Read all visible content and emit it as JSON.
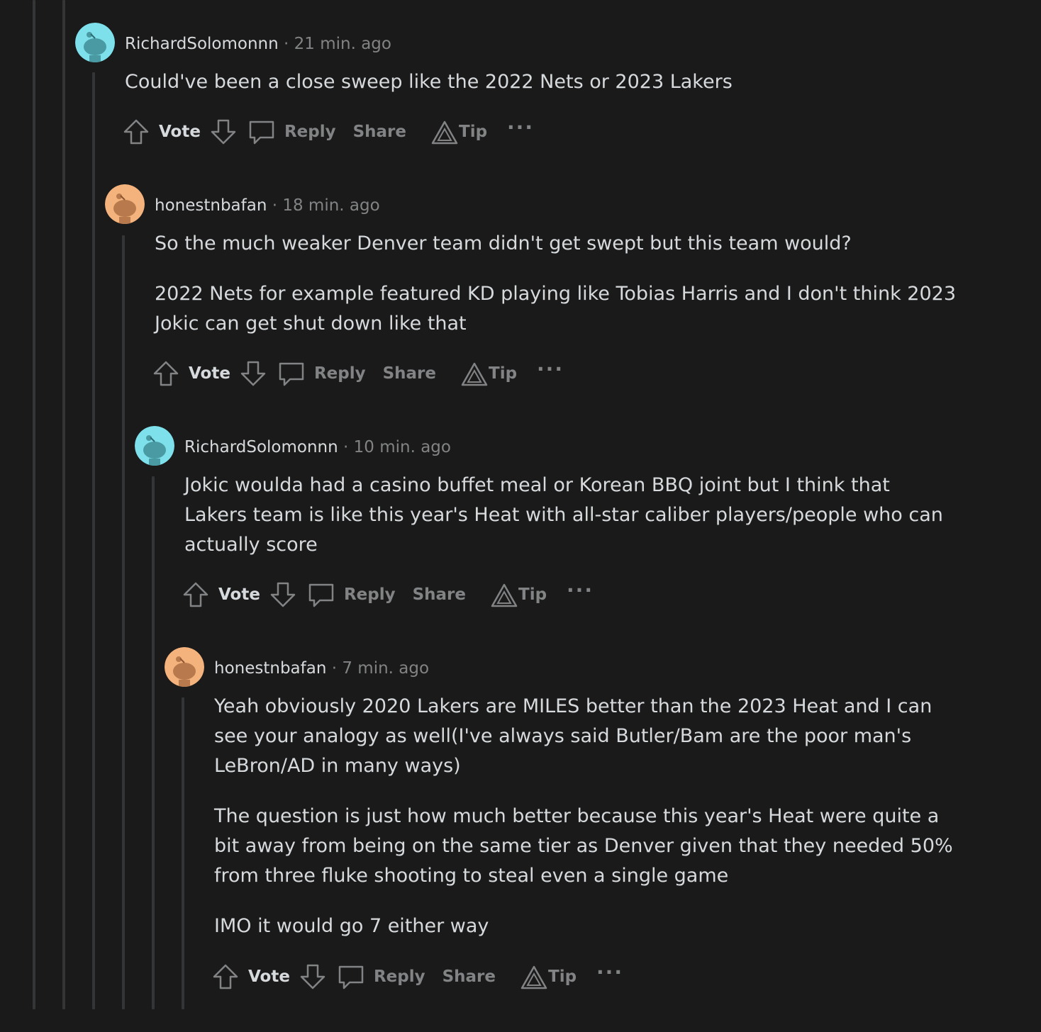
{
  "colors": {
    "background": "#1a1a1b",
    "thread_line": "#343536",
    "text": "#d7dadc",
    "muted": "#818384",
    "avatar_teal": "#7ee0eb",
    "avatar_orange": "#f4b27c"
  },
  "comments": [
    {
      "author": "RichardSolomonnn",
      "time": "21 min. ago",
      "avatar_color": "#7ee0eb",
      "paragraphs": [
        "Could've been a close sweep like the 2022 Nets or 2023 Lakers"
      ],
      "actions": {
        "vote": "Vote",
        "reply": "Reply",
        "share": "Share",
        "tip": "Tip",
        "more": "···"
      }
    },
    {
      "author": "honestnbafan",
      "time": "18 min. ago",
      "avatar_color": "#f4b27c",
      "paragraphs": [
        "So the much weaker Denver team didn't get swept but this team would?",
        "2022 Nets for example featured KD playing like Tobias Harris and I don't think 2023 Jokic can get shut down like that"
      ],
      "actions": {
        "vote": "Vote",
        "reply": "Reply",
        "share": "Share",
        "tip": "Tip",
        "more": "···"
      }
    },
    {
      "author": "RichardSolomonnn",
      "time": "10 min. ago",
      "avatar_color": "#7ee0eb",
      "paragraphs": [
        "Jokic woulda had a casino buffet meal or Korean BBQ joint but I think that Lakers team is like this year's Heat with all-star caliber players/people who can actually score"
      ],
      "actions": {
        "vote": "Vote",
        "reply": "Reply",
        "share": "Share",
        "tip": "Tip",
        "more": "···"
      }
    },
    {
      "author": "honestnbafan",
      "time": "7 min. ago",
      "avatar_color": "#f4b27c",
      "paragraphs": [
        "Yeah obviously 2020 Lakers are MILES better than the 2023 Heat and I can see your analogy as well(I've always said Butler/Bam are the poor man's LeBron/AD in many ways)",
        "The question is just how much better because this year's Heat were quite a bit away from being on the same tier as Denver given that they needed 50% from three fluke shooting to steal even a single game",
        "IMO it would go 7 either way"
      ],
      "actions": {
        "vote": "Vote",
        "reply": "Reply",
        "share": "Share",
        "tip": "Tip",
        "more": "···"
      }
    }
  ]
}
